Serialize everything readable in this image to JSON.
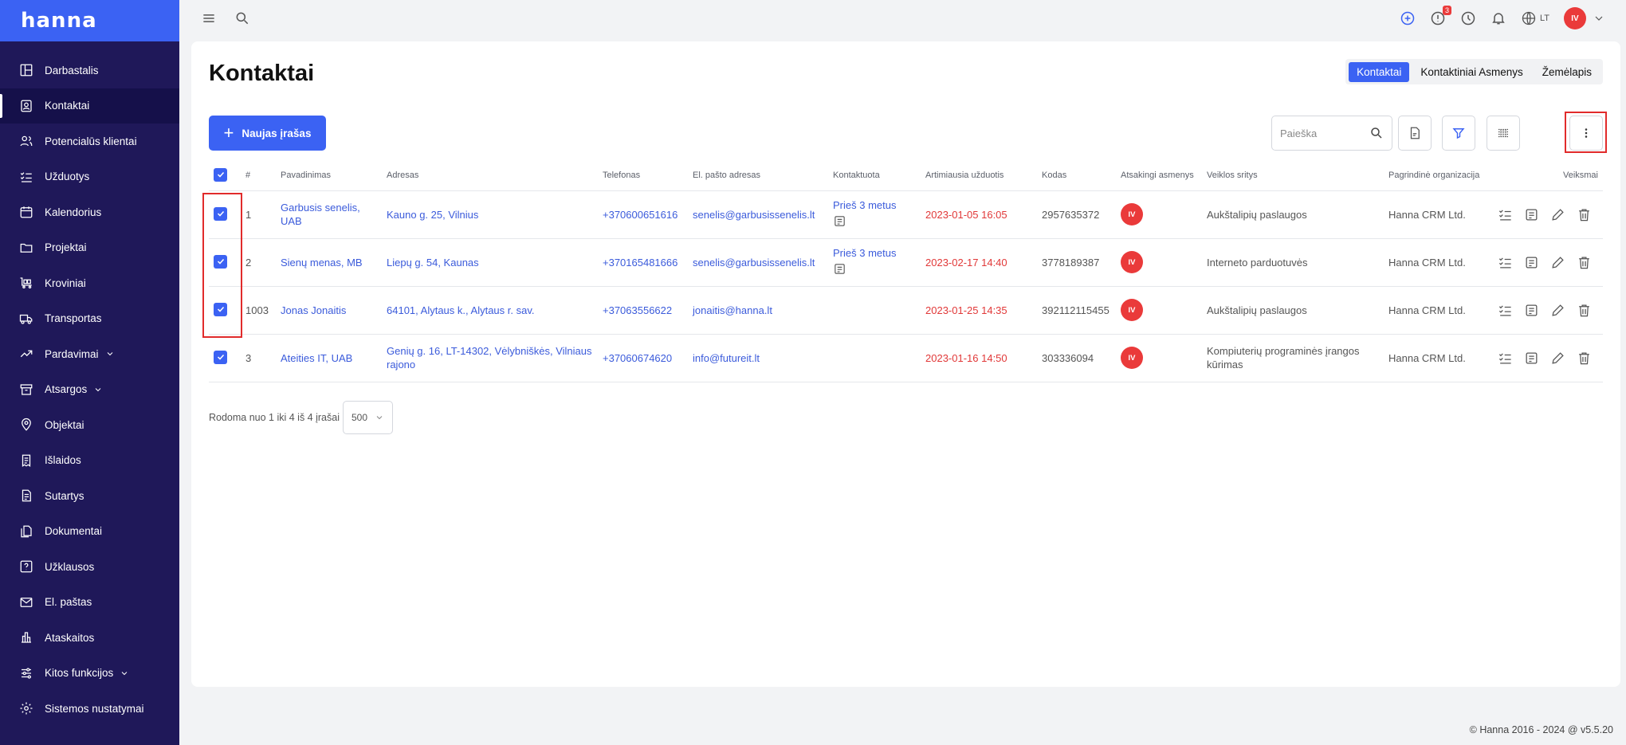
{
  "app": {
    "logo": "hanna",
    "footer": "© Hanna 2016 - 2024 @ v5.5.20"
  },
  "colors": {
    "accent": "#3b62f3",
    "sidebar": "#1f1859",
    "danger": "#ea3a3a",
    "highlight": "#e12b2b"
  },
  "sidebar": {
    "items": [
      {
        "label": "Darbastalis",
        "icon": "dashboard-icon"
      },
      {
        "label": "Kontaktai",
        "icon": "contacts-icon",
        "active": true
      },
      {
        "label": "Potencialūs klientai",
        "icon": "leads-icon"
      },
      {
        "label": "Užduotys",
        "icon": "tasks-icon"
      },
      {
        "label": "Kalendorius",
        "icon": "calendar-icon"
      },
      {
        "label": "Projektai",
        "icon": "folder-icon"
      },
      {
        "label": "Kroviniai",
        "icon": "cargo-icon"
      },
      {
        "label": "Transportas",
        "icon": "truck-icon"
      },
      {
        "label": "Pardavimai",
        "icon": "trend-icon",
        "expandable": true
      },
      {
        "label": "Atsargos",
        "icon": "box-icon",
        "expandable": true
      },
      {
        "label": "Objektai",
        "icon": "location-icon"
      },
      {
        "label": "Išlaidos",
        "icon": "receipt-icon"
      },
      {
        "label": "Sutartys",
        "icon": "contract-icon"
      },
      {
        "label": "Dokumentai",
        "icon": "documents-icon"
      },
      {
        "label": "Užklausos",
        "icon": "question-icon"
      },
      {
        "label": "El. paštas",
        "icon": "mail-icon"
      },
      {
        "label": "Ataskaitos",
        "icon": "chart-icon"
      },
      {
        "label": "Kitos funkcijos",
        "icon": "sliders-icon",
        "expandable": true
      },
      {
        "label": "Sistemos nustatymai",
        "icon": "gear-icon"
      }
    ]
  },
  "topbar": {
    "notifications_count": "3",
    "language": "LT",
    "user_initials": "IV"
  },
  "page": {
    "title": "Kontaktai",
    "view_tabs": [
      "Kontaktai",
      "Kontaktiniai Asmenys",
      "Žemėlapis"
    ],
    "new_button": "Naujas įrašas",
    "search_placeholder": "Paieška"
  },
  "table": {
    "columns": [
      "#",
      "Pavadinimas",
      "Adresas",
      "Telefonas",
      "El. pašto adresas",
      "Kontaktuota",
      "Artimiausia užduotis",
      "Kodas",
      "Atsakingi asmenys",
      "Veiklos sritys",
      "Pagrindinė organizacija",
      "Veiksmai"
    ],
    "rows": [
      {
        "num": "1",
        "name": "Garbusis senelis, UAB",
        "address": "Kauno g. 25, Vilnius",
        "phone": "+370600651616",
        "email": "senelis@garbusissenelis.lt",
        "contacted": "Prieš 3 metus",
        "next_task": "2023-01-05 16:05",
        "code": "2957635372",
        "responsible": "IV",
        "activity": "Aukštalipių paslaugos",
        "org": "Hanna CRM Ltd."
      },
      {
        "num": "2",
        "name": "Sienų menas, MB",
        "address": "Liepų g. 54, Kaunas",
        "phone": "+370165481666",
        "email": "senelis@garbusissenelis.lt",
        "contacted": "Prieš 3 metus",
        "next_task": "2023-02-17 14:40",
        "code": "3778189387",
        "responsible": "IV",
        "activity": "Interneto parduotuvės",
        "org": "Hanna CRM Ltd."
      },
      {
        "num": "1003",
        "name": "Jonas Jonaitis",
        "address": "64101, Alytaus k., Alytaus r. sav.",
        "phone": "+37063556622",
        "email": "jonaitis@hanna.lt",
        "contacted": "",
        "next_task": "2023-01-25 14:35",
        "code": "392112115455",
        "responsible": "IV",
        "activity": "Aukštalipių paslaugos",
        "org": "Hanna CRM Ltd."
      },
      {
        "num": "3",
        "name": "Ateities IT, UAB",
        "address": "Genių g. 16, LT-14302, Vėlybniškės, Vilniaus rajono",
        "phone": "+37060674620",
        "email": "info@futureit.lt",
        "contacted": "",
        "next_task": "2023-01-16 14:50",
        "code": "303336094",
        "responsible": "IV",
        "activity": "Kompiuterių programinės įrangos kūrimas",
        "org": "Hanna CRM Ltd."
      }
    ]
  },
  "pagination": {
    "summary": "Rodoma nuo 1 iki 4 iš 4 įrašai",
    "page_size": "500"
  }
}
